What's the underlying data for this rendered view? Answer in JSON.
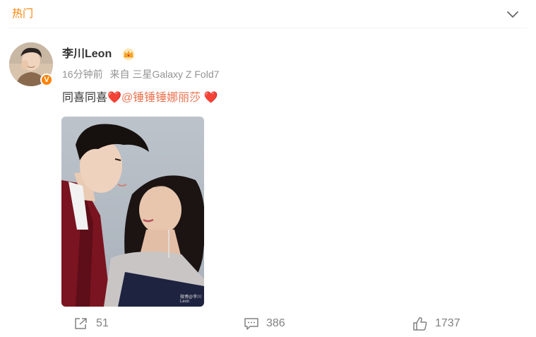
{
  "section": {
    "title": "热门"
  },
  "post": {
    "author": "李川Leon",
    "verified_badge": "V",
    "time": "16分钟前",
    "source_prefix": "来自",
    "source": "三星Galaxy Z Fold7",
    "text_before": "同喜同喜",
    "mention": "@锤锤锤娜丽莎",
    "image_watermark": "微博@李川Leon"
  },
  "actions": {
    "repost_count": "51",
    "comment_count": "386",
    "like_count": "1737"
  },
  "icons": {
    "expand": "chevron-down-icon",
    "crown": "crown-icon",
    "repost": "repost-icon",
    "comment": "comment-icon",
    "like": "thumbs-up-icon"
  },
  "colors": {
    "accent": "#ff8200",
    "mention": "#eb7350",
    "heart": "#e0243f",
    "text": "#333333",
    "meta": "#939393"
  }
}
